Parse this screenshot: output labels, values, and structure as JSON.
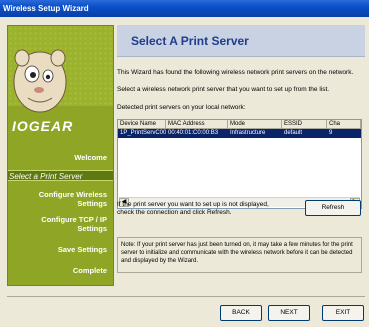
{
  "window": {
    "title": "Wireless Setup Wizard"
  },
  "brand": {
    "logo": "IOGEAR"
  },
  "sidebar": {
    "steps": [
      {
        "label": "Welcome"
      },
      {
        "label": "Select a Print Server"
      },
      {
        "label": "Configure Wireless Settings"
      },
      {
        "label": "Configure TCP / IP Settings"
      },
      {
        "label": "Save Settings"
      },
      {
        "label": "Complete"
      }
    ],
    "accent": "#8fa526"
  },
  "main": {
    "heading": "Select A Print Server",
    "intro_line1": "This Wizard has found the following wireless network print servers on the network.",
    "intro_line2": "Select a wireless network print server that you want to set up from the list.",
    "detected_label": "Detected print servers on your local network:",
    "table": {
      "columns": [
        "Device Name",
        "MAC Address",
        "Mode",
        "ESSID",
        "Cha"
      ],
      "rows": [
        [
          "1P_PrintServC000B3",
          "00:40:01:C0:00:B3",
          "Infrastructure",
          "default",
          "9"
        ]
      ]
    },
    "refresh_hint": "If the print server you want to set up is not displayed, check the connection and click Refresh.",
    "refresh_label": "Refresh",
    "note": "Note: If your print server has just been turned on, it may take a few minutes for the print server to initialize and communicate with the wireless network before it can be detected and displayed by the Wizard."
  },
  "footer": {
    "back": "BACK",
    "next": "NEXT",
    "exit": "EXIT"
  }
}
